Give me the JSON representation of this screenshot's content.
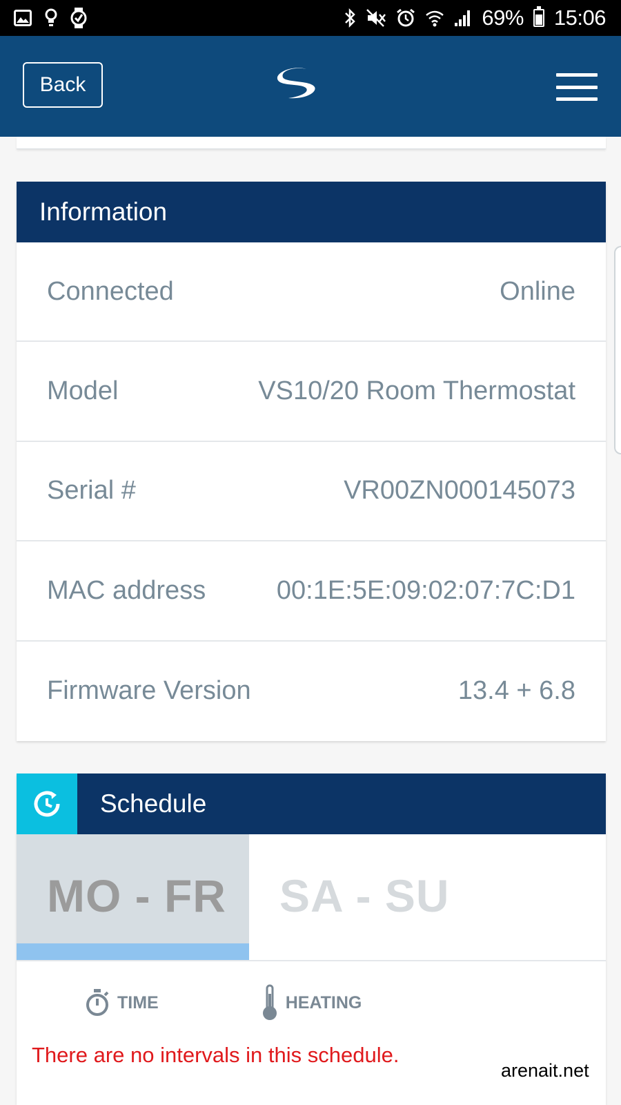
{
  "status_bar": {
    "left_icons": [
      "image-icon",
      "lightbulb-icon",
      "watch-icon"
    ],
    "right_icons": [
      "bluetooth-icon",
      "mute-icon",
      "alarm-icon",
      "wifi-icon",
      "signal-icon"
    ],
    "battery": "69%",
    "time": "15:06"
  },
  "header": {
    "back_label": "Back",
    "logo": "brand-logo-icon",
    "menu_icon": "hamburger-menu-icon",
    "background_color": "#0e4a7c"
  },
  "information": {
    "title": "Information",
    "rows": [
      {
        "label": "Connected",
        "value": "Online"
      },
      {
        "label": "Model",
        "value": "VS10/20 Room Thermostat"
      },
      {
        "label": "Serial #",
        "value": "VR00ZN000145073"
      },
      {
        "label": "MAC address",
        "value": "00:1E:5E:09:02:07:7C:D1"
      },
      {
        "label": "Firmware Version",
        "value": "13.4 + 6.8"
      }
    ]
  },
  "schedule": {
    "title": "Schedule",
    "icon": "schedule-clock-icon",
    "tabs": [
      {
        "label": "MO - FR",
        "active": true
      },
      {
        "label": "SA - SU",
        "active": false
      }
    ],
    "legend": {
      "time_label": "TIME",
      "heating_label": "HEATING"
    },
    "empty_message": "There are no intervals in this schedule."
  },
  "watermark": "arenait.net",
  "colors": {
    "card_header": "#0c3466",
    "schedule_icon_bg": "#0bbfe0",
    "active_tab_indicator": "#8fc3ef",
    "error_text": "#e0191c"
  }
}
